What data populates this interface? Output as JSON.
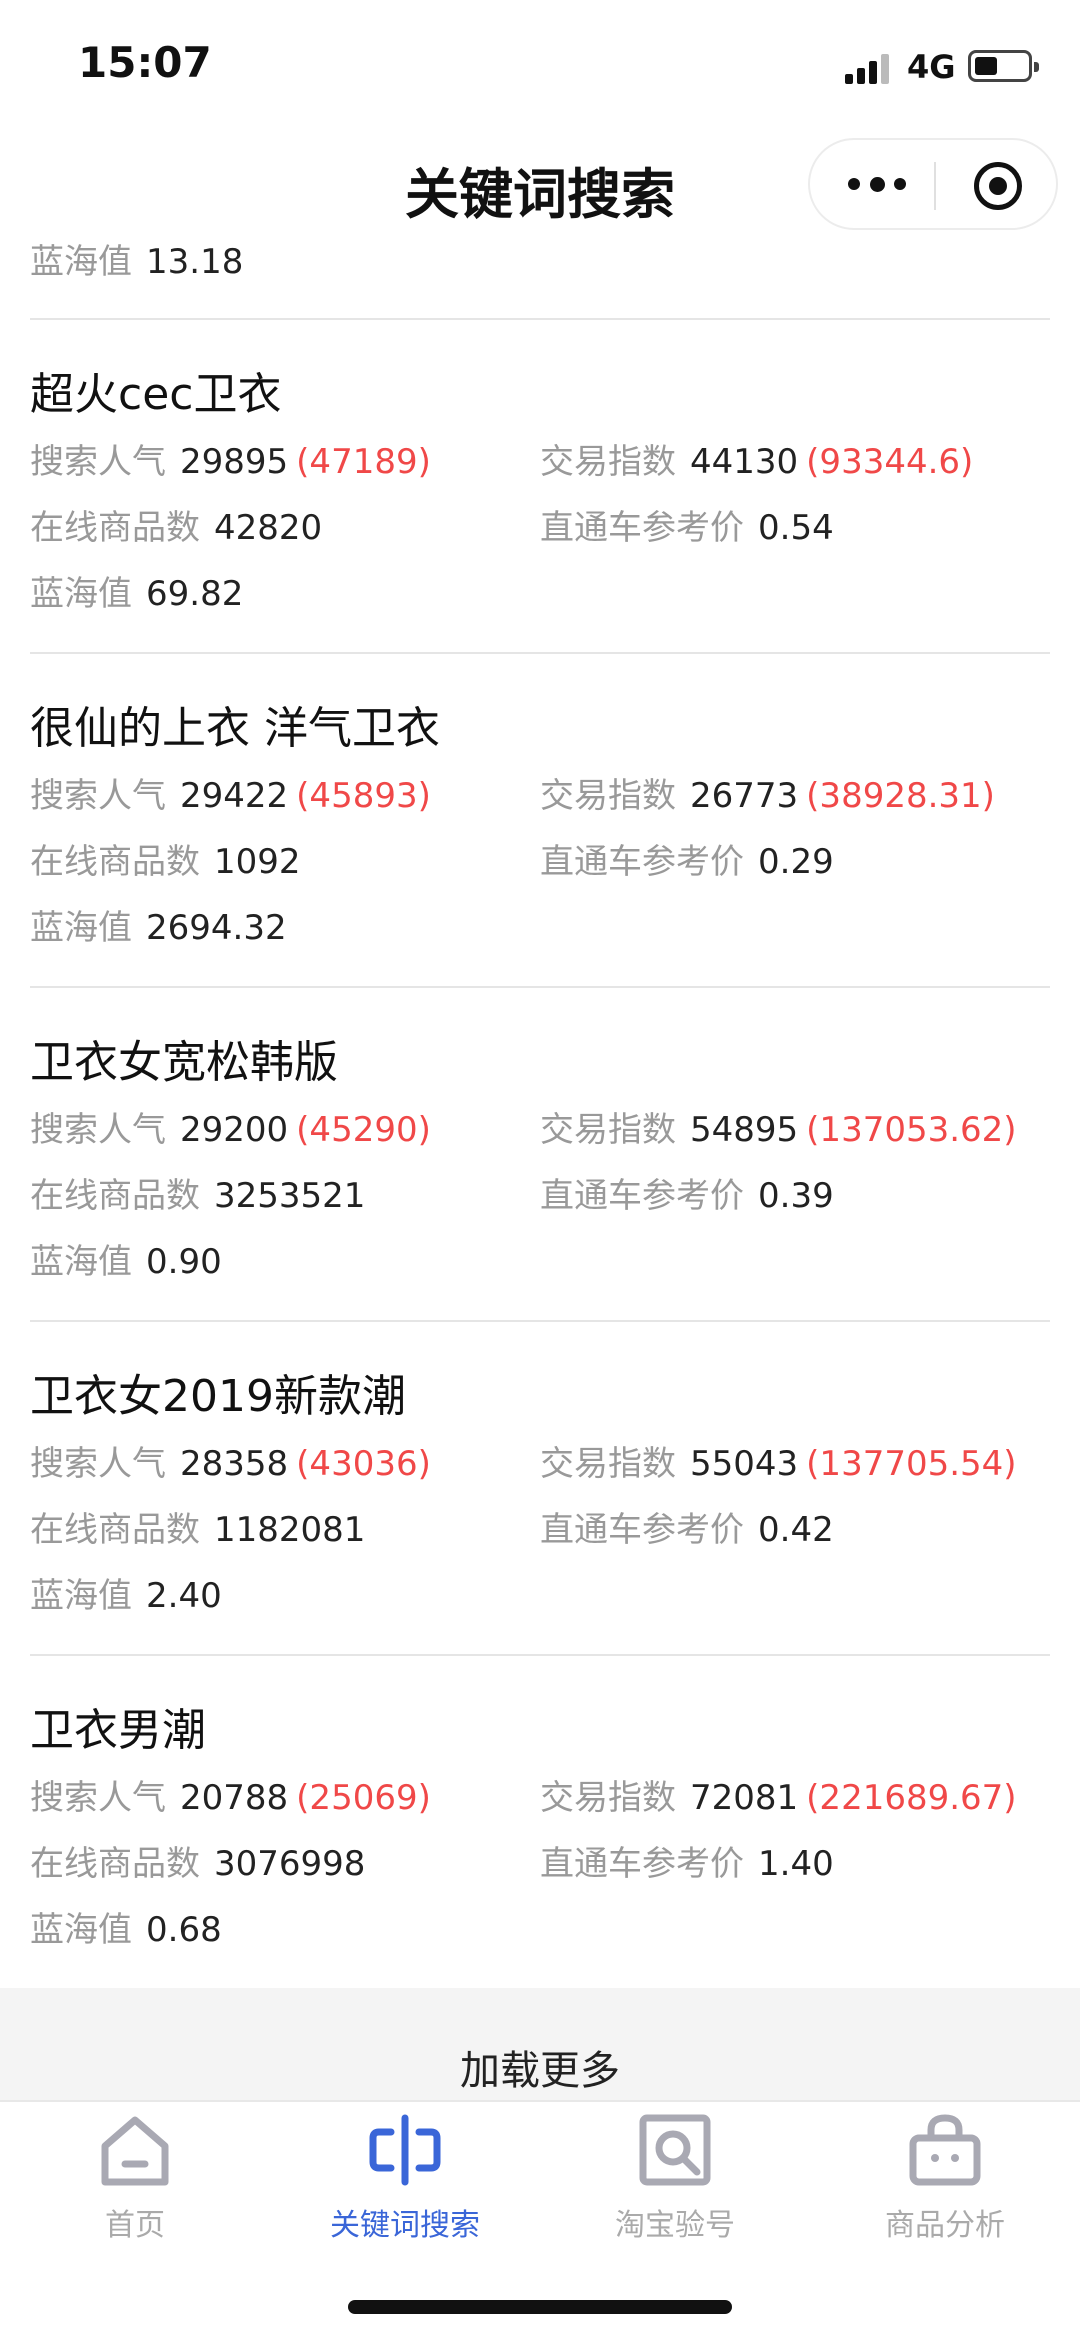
{
  "status": {
    "time": "15:07",
    "network": "4G"
  },
  "nav": {
    "title": "关键词搜索"
  },
  "labels": {
    "search_pop": "搜索人气",
    "trade_index": "交易指数",
    "online_goods": "在线商品数",
    "ztc_price": "直通车参考价",
    "blue_sea": "蓝海值"
  },
  "partial": {
    "blue_sea": "13.18"
  },
  "keywords": [
    {
      "name": "超火cec卫衣",
      "search_pop": "29895",
      "search_pop_est": "(47189)",
      "trade_index": "44130",
      "trade_index_est": "(93344.6)",
      "online_goods": "42820",
      "ztc_price": "0.54",
      "blue_sea": "69.82"
    },
    {
      "name": "很仙的上衣 洋气卫衣",
      "search_pop": "29422",
      "search_pop_est": "(45893)",
      "trade_index": "26773",
      "trade_index_est": "(38928.31)",
      "online_goods": "1092",
      "ztc_price": "0.29",
      "blue_sea": "2694.32"
    },
    {
      "name": "卫衣女宽松韩版",
      "search_pop": "29200",
      "search_pop_est": "(45290)",
      "trade_index": "54895",
      "trade_index_est": "(137053.62)",
      "online_goods": "3253521",
      "ztc_price": "0.39",
      "blue_sea": "0.90"
    },
    {
      "name": "卫衣女2019新款潮",
      "search_pop": "28358",
      "search_pop_est": "(43036)",
      "trade_index": "55043",
      "trade_index_est": "(137705.54)",
      "online_goods": "1182081",
      "ztc_price": "0.42",
      "blue_sea": "2.40"
    },
    {
      "name": "卫衣男潮",
      "search_pop": "20788",
      "search_pop_est": "(25069)",
      "trade_index": "72081",
      "trade_index_est": "(221689.67)",
      "online_goods": "3076998",
      "ztc_price": "1.40",
      "blue_sea": "0.68"
    }
  ],
  "load_more": "加载更多",
  "tabs": [
    {
      "label": "首页",
      "icon": "home-icon"
    },
    {
      "label": "关键词搜索",
      "icon": "keyword-search-icon"
    },
    {
      "label": "淘宝验号",
      "icon": "account-check-icon"
    },
    {
      "label": "商品分析",
      "icon": "shopping-bag-icon"
    }
  ],
  "colors": {
    "accent": "#3a66d8",
    "highlight": "#f04848",
    "label": "#999999"
  }
}
